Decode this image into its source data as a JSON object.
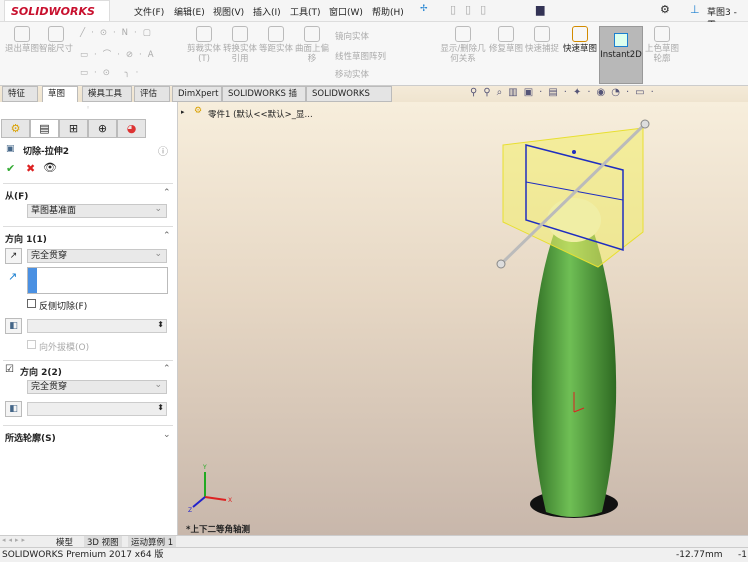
{
  "app": {
    "logo": "SOLIDWORKS",
    "doc_title": "草图3 - 零"
  },
  "menu": [
    "文件(F)",
    "编辑(E)",
    "视图(V)",
    "插入(I)",
    "工具(T)",
    "窗口(W)",
    "帮助(H)"
  ],
  "ribbon": {
    "exit_sketch": "退出草图",
    "smart_dim": "智能尺寸",
    "trim": "剪裁实体(T)",
    "convert": "转换实体引用",
    "offset": "等距实体",
    "surface_offset": "曲面上偏移",
    "mirror": "镜向实体",
    "linear_pattern": "线性草图阵列",
    "move": "移动实体",
    "relations": "显示/删除几何关系",
    "repair": "修复草图",
    "quick_snap": "快速捕捉",
    "rapid_sketch": "快速草图",
    "instant2d": "Instant2D",
    "shaded_sketch": "上色草图轮廓"
  },
  "tabs": [
    "特征",
    "草图",
    "模具工具",
    "评估",
    "DimXpert",
    "SOLIDWORKS 插件",
    "SOLIDWORKS MBD"
  ],
  "active_tab": "草图",
  "panel": {
    "title": "切除-拉伸2",
    "from_label": "从(F)",
    "from_value": "草图基准面",
    "dir1_label": "方向 1(1)",
    "dir1_value": "完全贯穿",
    "flip_side": "反侧切除(F)",
    "draft_outward": "向外拔模(O)",
    "dir2_label": "方向 2(2)",
    "dir2_value": "完全贯穿",
    "dir2_checked": true,
    "flip_checked": false,
    "contours_label": "所选轮廓(S)"
  },
  "viewport": {
    "tree_item": "零件1  (默认<<默认>_显...",
    "view_name": "*上下二等角轴测",
    "axis_labels": [
      "Y",
      "X",
      "Z"
    ]
  },
  "bottom_tabs": [
    "模型",
    "3D 视图",
    "运动算例 1"
  ],
  "status": {
    "product": "SOLIDWORKS Premium 2017 x64 版",
    "coord": "-12.77mm",
    "extra": "-1"
  },
  "colors": {
    "accent": "#c8102e",
    "body": "#4e9a3c",
    "box": "#f3ee6a",
    "sketch": "#1f2ec0"
  }
}
